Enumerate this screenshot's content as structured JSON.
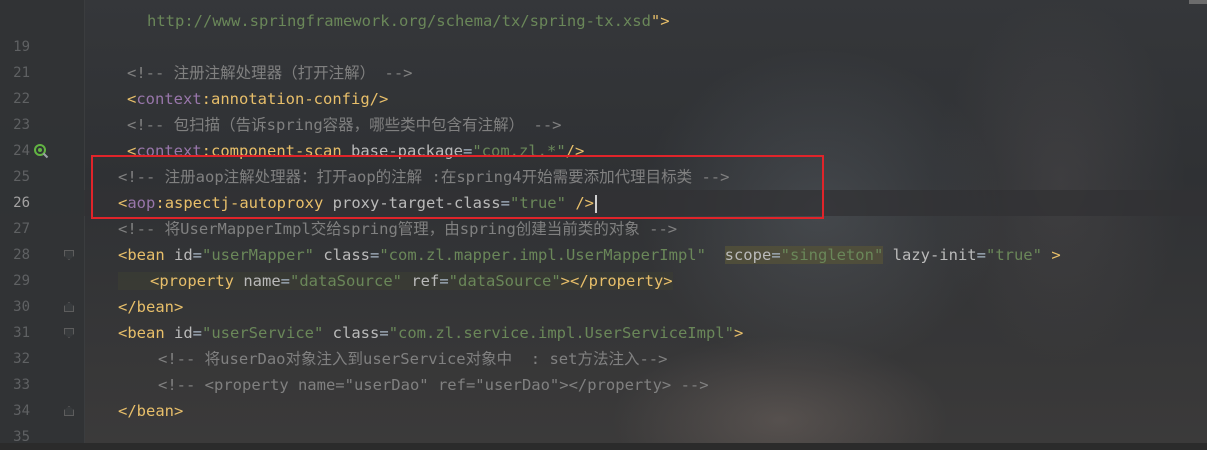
{
  "line_numbers": [
    "",
    "19",
    "",
    "21",
    "22",
    "23",
    "24",
    "25",
    "26",
    "27",
    "28",
    "29",
    "30",
    "31",
    "32",
    "33",
    "34",
    "35"
  ],
  "current_line": "26",
  "code": {
    "l18": {
      "url": "http://www.springframework.org/schema/tx/spring-tx.xsd",
      "close": "\">"
    },
    "l21": {
      "comment": "<!-- 注册注解处理器（打开注解） -->"
    },
    "l22": {
      "open": "<",
      "ns": "context",
      "colon": ":",
      "tag": "annotation-config",
      "close": "/>"
    },
    "l23": {
      "comment": "<!-- 包扫描（告诉spring容器，哪些类中包含有注解） -->"
    },
    "l24": {
      "open": "<",
      "ns": "context",
      "colon": ":",
      "tag": "component-scan",
      "attr": " base-package",
      "eq": "=",
      "val": "\"com.zl.*\"",
      "close": "/>"
    },
    "l25": {
      "comment": "<!-- 注册aop注解处理器：打开aop的注解 :在spring4开始需要添加代理目标类 -->"
    },
    "l26": {
      "open": "<",
      "ns": "aop",
      "colon": ":",
      "tag": "aspectj-autoproxy",
      "attr": " proxy-target-class",
      "eq": "=",
      "val": "\"true\"",
      "close": " />"
    },
    "l27": {
      "comment": "<!-- 将UserMapperImpl交给spring管理，由spring创建当前类的对象 -->"
    },
    "l28": {
      "open": "<bean",
      "a1": " id",
      "eq1": "=",
      "v1": "\"userMapper\"",
      "a2": " class",
      "eq2": "=",
      "v2": "\"com.zl.mapper.impl.UserMapperImpl\"",
      "gap": "  ",
      "a3": "scope",
      "eq3": "=",
      "v3": "\"singleton\"",
      "a4": " lazy-init",
      "eq4": "=",
      "v4": "\"true\"",
      "close": " >"
    },
    "l29": {
      "open": "<property",
      "a1": " name",
      "eq1": "=",
      "v1": "\"dataSource\"",
      "a2": " ref",
      "eq2": "=",
      "v2": "\"dataSource\"",
      "close": "></property>"
    },
    "l30": {
      "text": "</bean>"
    },
    "l31": {
      "open": "<bean",
      "a1": " id",
      "eq1": "=",
      "v1": "\"userService\"",
      "a2": " class",
      "eq2": "=",
      "v2": "\"com.zl.service.impl.UserServiceImpl\"",
      "close": ">"
    },
    "l32": {
      "comment": "<!-- 将userDao对象注入到userService对象中  : set方法注入-->"
    },
    "l33": {
      "comment": "<!-- <property name=\"userDao\" ref=\"userDao\"></property> -->"
    },
    "l34": {
      "text": "</bean>"
    }
  }
}
